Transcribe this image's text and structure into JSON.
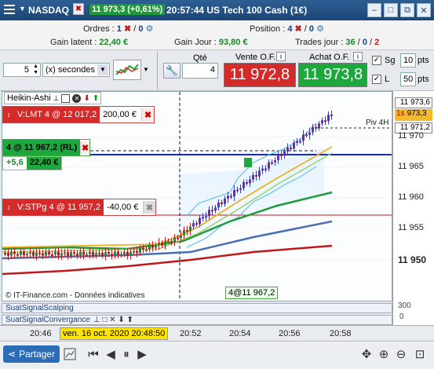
{
  "title": {
    "instrument": "NASDAQ",
    "price_change": "11 973,3 (+0,61%)",
    "time_desc": "20:57:44 US Tech 100 Cash (1€)"
  },
  "info": {
    "orders_label": "Ordres :",
    "orders_a": "1",
    "orders_b": "0",
    "positions_label": "Position :",
    "positions_a": "4",
    "positions_b": "0",
    "latent_label": "Gain latent :",
    "latent_value": "22,40 €",
    "day_label": "Gain Jour :",
    "day_value": "93,80 €",
    "trades_label": "Trades jour :",
    "trades_a": "36",
    "trades_b": "0",
    "trades_c": "2",
    "sep": "/"
  },
  "toolbar": {
    "period_value": "5",
    "period_unit": "(x) secondes",
    "qty_label": "Qté",
    "qty_value": "4",
    "sell_label": "Vente O.F.",
    "sell_price": "11 972,8",
    "buy_label": "Achat O.F.",
    "buy_price": "11 973,8",
    "sg_label": "Sg",
    "sg_value": "10",
    "l_label": "L",
    "l_value": "50",
    "pts": "pts"
  },
  "chart": {
    "indicator": "Heikin-Ashi",
    "copyright": "© IT-Finance.com - Données indicatives",
    "piv_label": "Piv 4H",
    "position_label": "4@11 967,2"
  },
  "orders": {
    "limit": {
      "label": "V:LMT 4 @ 12 017,2",
      "value": "200,00 €"
    },
    "position": {
      "label": "4 @ 11 967,2 (RL)",
      "pts": "+5,6",
      "value": "22,40 €"
    },
    "stop": {
      "label": "V:STPg 4 @ 11 957,2",
      "value": "-40,00 €"
    }
  },
  "yaxis": {
    "labels": [
      "11 970",
      "11 965",
      "11 960",
      "11 955",
      "11 950"
    ],
    "ask": "11 973,6",
    "current": "973,3",
    "current_prefix": "1s",
    "bid": "11 971,2",
    "sub_value": "300",
    "sub_zero": "0"
  },
  "subpanels": [
    "SuatSignalScalping",
    "SuatSignalConvergance"
  ],
  "time": {
    "labels": [
      "20:46",
      "20:52",
      "20:54",
      "20:56",
      "20:58"
    ],
    "cursor": "ven. 16 oct. 2020 20:48:50"
  },
  "bottom": {
    "share": "Partager"
  },
  "colors": {
    "sell": "#d42a2a",
    "buy": "#1da83d",
    "title": "#1b4676"
  }
}
